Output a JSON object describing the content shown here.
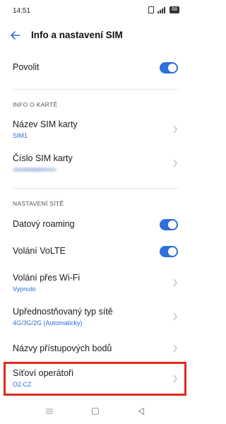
{
  "status_bar": {
    "time": "14:51",
    "battery": "68"
  },
  "header": {
    "title": "Info a nastavení SIM"
  },
  "enable": {
    "label": "Povolit",
    "on": true
  },
  "card_info": {
    "section_title": "INFO O KARTĚ",
    "sim_name": {
      "label": "Název SIM karty",
      "value": "SIM1"
    },
    "sim_number": {
      "label": "Číslo SIM karty"
    }
  },
  "network_settings": {
    "section_title": "NASTAVENÍ SÍTĚ",
    "data_roaming": {
      "label": "Datový roaming",
      "on": true
    },
    "volte": {
      "label": "Volání VoLTE",
      "on": true
    },
    "wifi_calling": {
      "label": "Volání přes Wi-Fi",
      "value": "Vypnuto"
    },
    "preferred_network": {
      "label": "Upřednostňovaný typ sítě",
      "value": "4G/3G/2G (Automaticky)"
    },
    "apn": {
      "label": "Názvy přístupových bodů"
    },
    "operators": {
      "label": "Síťoví operátoři",
      "value": "O2.CZ"
    }
  },
  "colors": {
    "accent": "#2f6fde",
    "highlight": "#e02a20"
  }
}
